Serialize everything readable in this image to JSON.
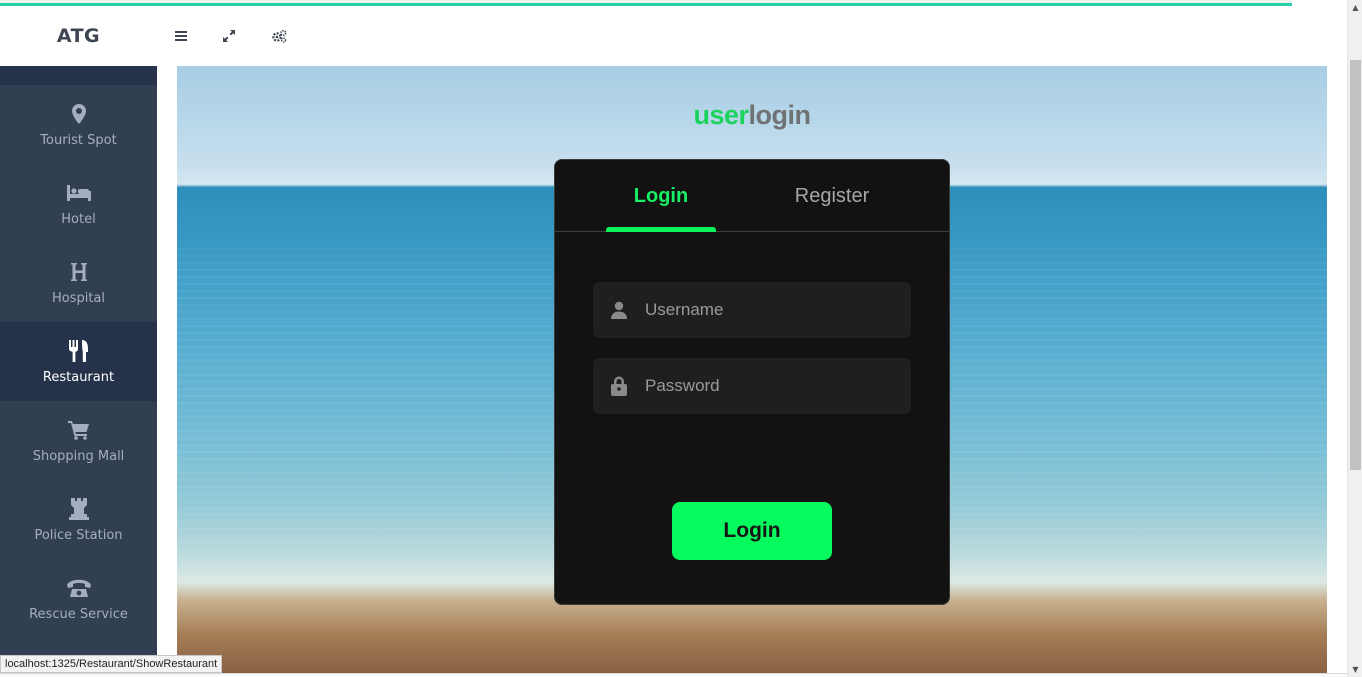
{
  "app": {
    "brand": "ATG"
  },
  "toolbar": {
    "menu_icon": "hamburger-menu-icon",
    "fullscreen_icon": "expand-icon",
    "settings_icon": "cogs-icon"
  },
  "sidebar": {
    "items": [
      {
        "label": "Tourist Spot",
        "icon": "map-marker-icon",
        "active": false
      },
      {
        "label": "Hotel",
        "icon": "bed-icon",
        "active": false
      },
      {
        "label": "Hospital",
        "icon": "hospital-h-icon",
        "active": false
      },
      {
        "label": "Restaurant",
        "icon": "cutlery-icon",
        "active": true
      },
      {
        "label": "Shopping Mall",
        "icon": "shopping-cart-icon",
        "active": false
      },
      {
        "label": "Police Station",
        "icon": "tower-icon",
        "active": false
      },
      {
        "label": "Rescue Service",
        "icon": "phone-icon",
        "active": false
      }
    ]
  },
  "heading": {
    "part1": "user",
    "part2": "login"
  },
  "login_card": {
    "tabs": [
      {
        "label": "Login",
        "active": true
      },
      {
        "label": "Register",
        "active": false
      }
    ],
    "username_placeholder": "Username",
    "password_placeholder": "Password",
    "submit_label": "Login"
  },
  "status_bar": {
    "url": "localhost:1325/Restaurant/ShowRestaurant"
  },
  "colors": {
    "accent_green": "#0bf25b",
    "sidebar_bg": "#323f52",
    "card_bg": "#121212"
  }
}
